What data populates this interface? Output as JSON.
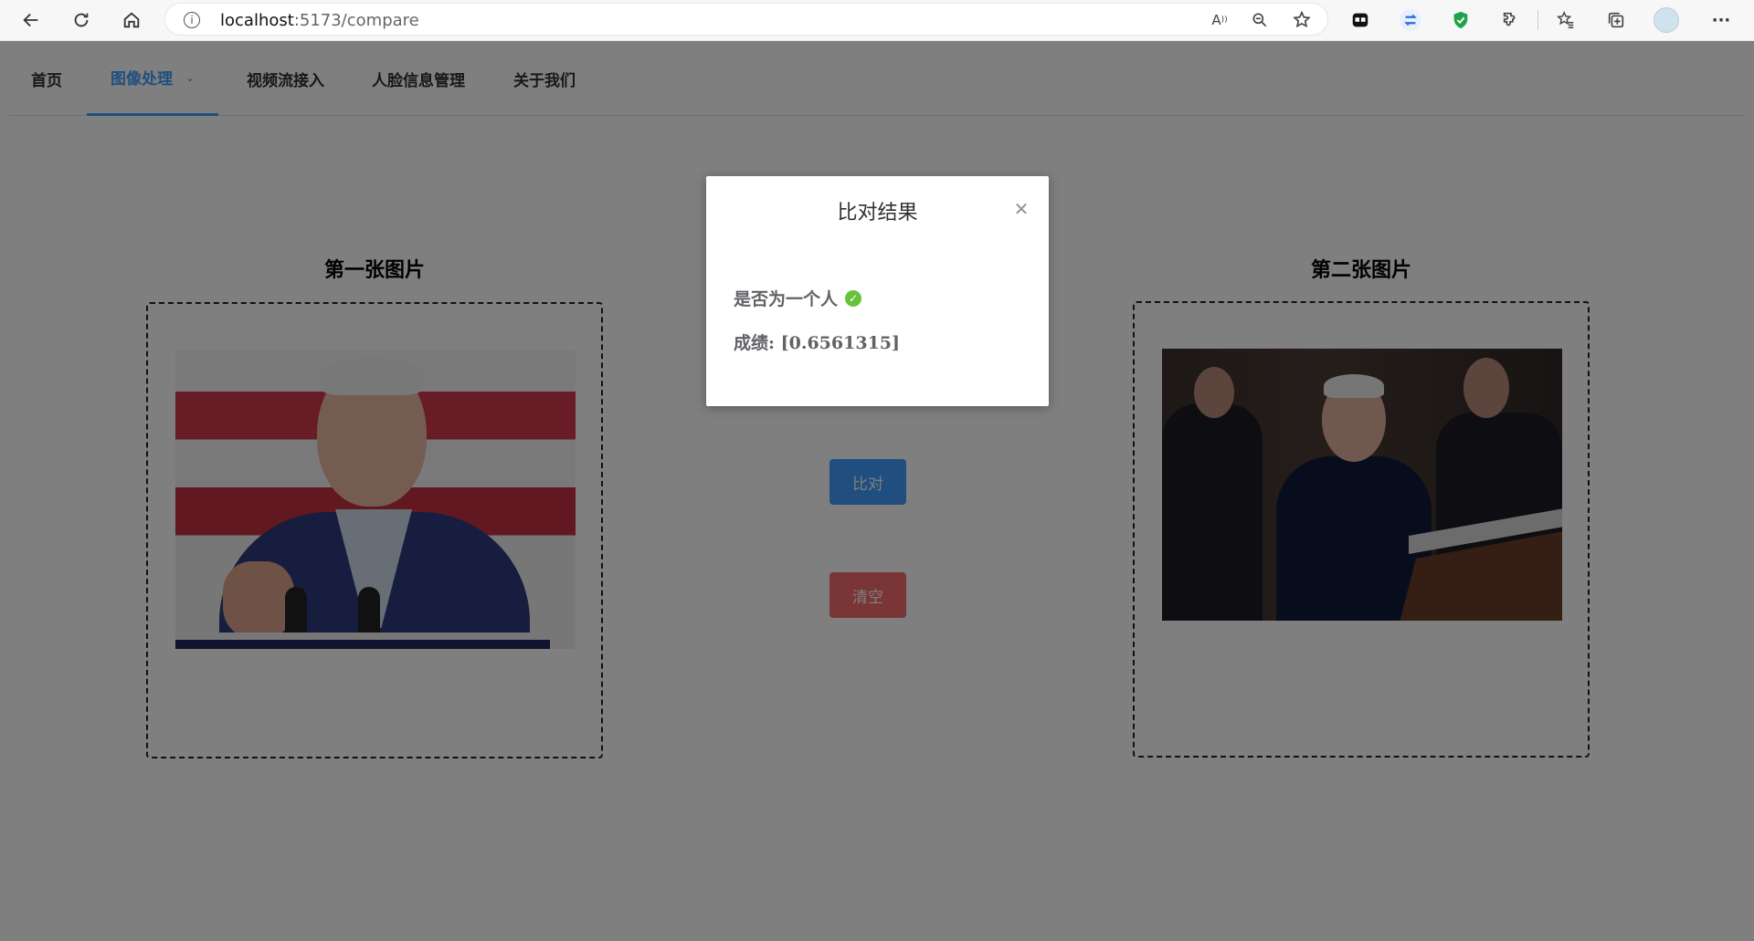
{
  "browser": {
    "url_host": "localhost",
    "url_path": ":5173/compare"
  },
  "menu": {
    "items": [
      {
        "label": "首页"
      },
      {
        "label": "图像处理"
      },
      {
        "label": "视频流接入"
      },
      {
        "label": "人脸信息管理"
      },
      {
        "label": "关于我们"
      }
    ],
    "active_index": 1
  },
  "compare": {
    "first_title": "第一张图片",
    "second_title": "第二张图片",
    "compare_label": "比对",
    "clear_label": "清空"
  },
  "dialog": {
    "title": "比对结果",
    "same_person_label": "是否为一个人",
    "score_label": "成绩:",
    "score_value": "[0.6561315]"
  },
  "colors": {
    "primary": "#409eff",
    "danger": "#f56c6c",
    "success": "#67c23a"
  }
}
